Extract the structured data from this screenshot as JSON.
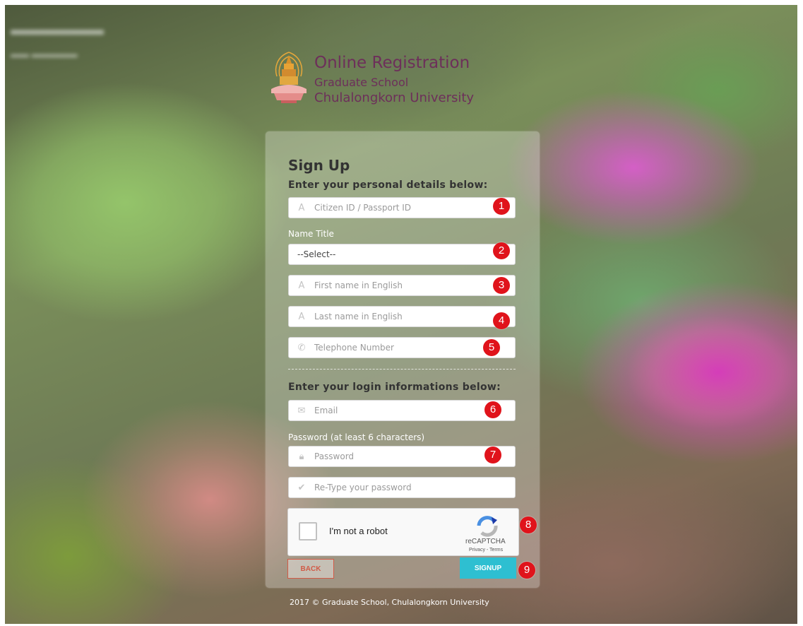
{
  "header": {
    "title": "Online Registration",
    "subtitle1": "Graduate School",
    "subtitle2": "Chulalongkorn University"
  },
  "form": {
    "title": "Sign Up",
    "personal_heading": "Enter your personal details below:",
    "citizen_placeholder": "Citizen ID / Passport ID",
    "name_title_label": "Name Title",
    "name_title_value": "--Select--",
    "first_name_placeholder": "First name in English",
    "last_name_placeholder": "Last name in English",
    "telephone_placeholder": "Telephone Number",
    "login_heading": "Enter your login informations below:",
    "email_placeholder": "Email",
    "password_label": "Password (at least 6 characters)",
    "password_placeholder": "Password",
    "retype_placeholder": "Re-Type your password"
  },
  "recaptcha": {
    "label": "I'm not a robot",
    "brand": "reCAPTCHA",
    "links": "Privacy - Terms"
  },
  "buttons": {
    "back": "BACK",
    "signup": "SIGNUP"
  },
  "markers": [
    "1",
    "2",
    "3",
    "4",
    "5",
    "6",
    "7",
    "8",
    "9"
  ],
  "footer": "2017 © Graduate School, Chulalongkorn University",
  "colors": {
    "marker": "#e0131b",
    "signup_button": "#2ebfd1",
    "back_button": "#d15b47",
    "brand": "#6d2f5a"
  }
}
